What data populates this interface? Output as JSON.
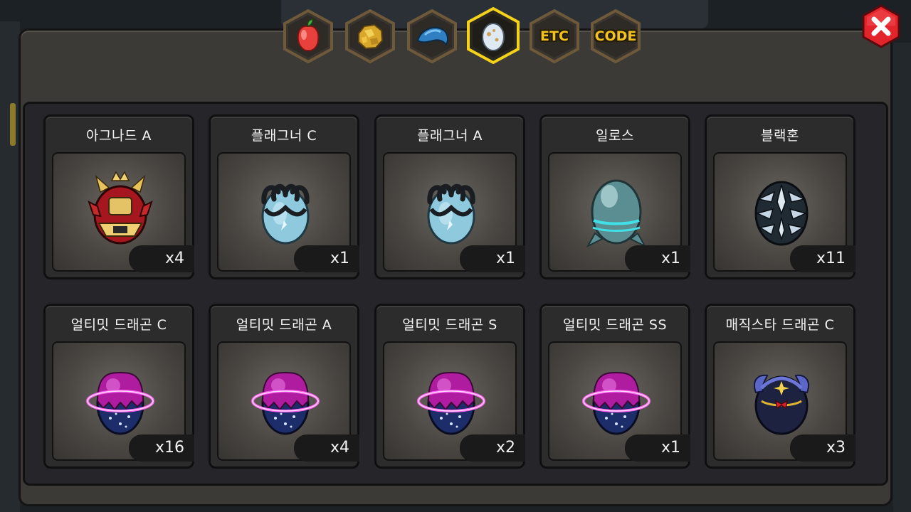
{
  "tabs": [
    {
      "icon": "fruit-icon",
      "label": "",
      "active": false
    },
    {
      "icon": "gold-ore-icon",
      "label": "",
      "active": false
    },
    {
      "icon": "blue-claw-icon",
      "label": "",
      "active": false
    },
    {
      "icon": "egg-icon",
      "label": "",
      "active": true
    },
    {
      "icon": "",
      "label": "ETC",
      "active": false
    },
    {
      "icon": "",
      "label": "CODE",
      "active": false
    }
  ],
  "close_icon": "close-icon",
  "items": [
    {
      "name": "아그나드 A",
      "count": "x4",
      "egg": "agnad"
    },
    {
      "name": "플래그너 C",
      "count": "x1",
      "egg": "flagner"
    },
    {
      "name": "플래그너 A",
      "count": "x1",
      "egg": "flagner"
    },
    {
      "name": "일로스",
      "count": "x1",
      "egg": "ilos"
    },
    {
      "name": "블랙혼",
      "count": "x11",
      "egg": "blackhorn"
    },
    {
      "name": "얼티밋 드래곤 C",
      "count": "x16",
      "egg": "ultimate"
    },
    {
      "name": "얼티밋 드래곤 A",
      "count": "x4",
      "egg": "ultimate"
    },
    {
      "name": "얼티밋 드래곤 S",
      "count": "x2",
      "egg": "ultimate"
    },
    {
      "name": "얼티밋 드래곤 SS",
      "count": "x1",
      "egg": "ultimate"
    },
    {
      "name": "매직스타 드래곤 C",
      "count": "x3",
      "egg": "magicstar"
    }
  ]
}
